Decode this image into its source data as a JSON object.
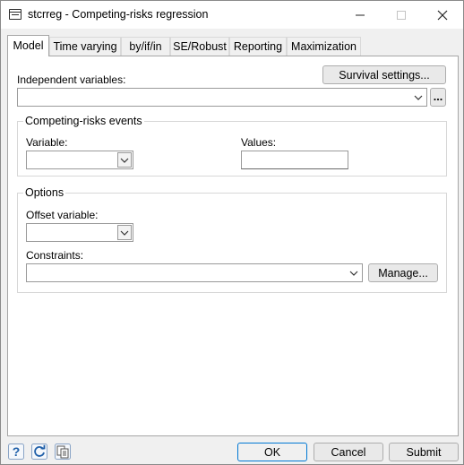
{
  "window": {
    "title": "stcrreg - Competing-risks regression"
  },
  "tabs": [
    {
      "label": "Model"
    },
    {
      "label": "Time varying"
    },
    {
      "label": "by/if/in"
    },
    {
      "label": "SE/Robust"
    },
    {
      "label": "Reporting"
    },
    {
      "label": "Maximization"
    }
  ],
  "model": {
    "independent_variables_label": "Independent variables:",
    "independent_variables_value": "",
    "survival_settings_label": "Survival settings...",
    "ellipsis_label": "...",
    "competing_risks": {
      "title": "Competing-risks events",
      "variable_label": "Variable:",
      "variable_value": "",
      "values_label": "Values:",
      "values_value": ""
    },
    "options": {
      "title": "Options",
      "offset_label": "Offset variable:",
      "offset_value": "",
      "constraints_label": "Constraints:",
      "constraints_value": "",
      "manage_label": "Manage..."
    }
  },
  "footer": {
    "ok_label": "OK",
    "cancel_label": "Cancel",
    "submit_label": "Submit"
  },
  "icons": {
    "help": "help-icon",
    "reset": "reset-icon",
    "copy": "copy-command-icon"
  }
}
